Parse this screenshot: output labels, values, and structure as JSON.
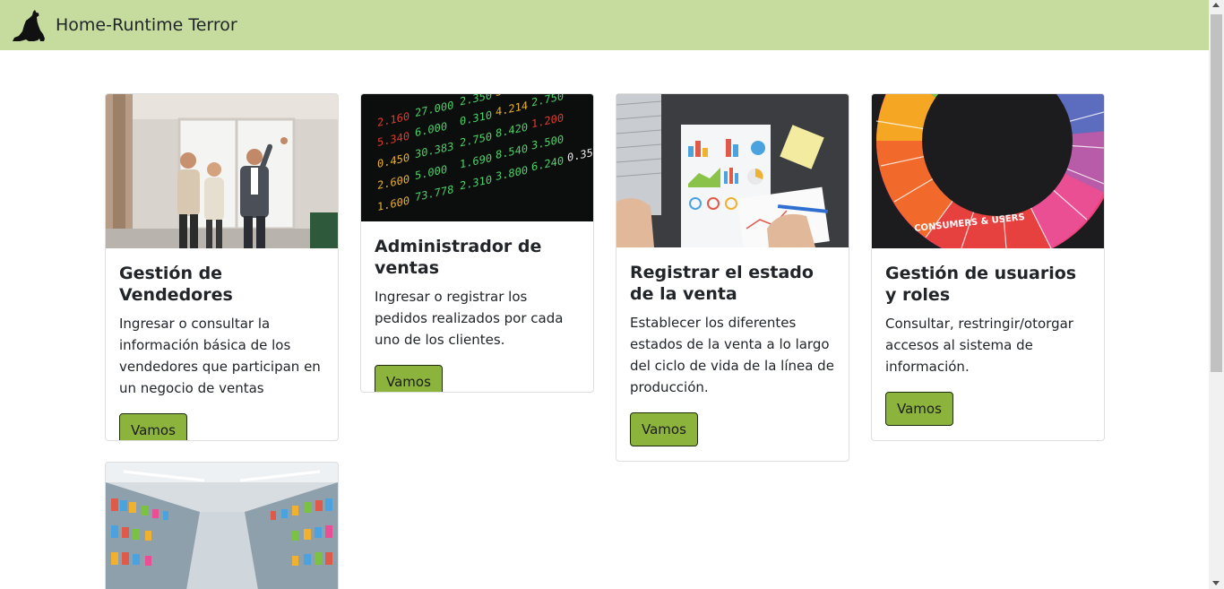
{
  "navbar": {
    "brand": "Home-Runtime Terror"
  },
  "cards": [
    {
      "title": "Gestión de Vendedores",
      "text": "Ingresar o consultar la información básica de los vendedores que participan en un negocio de ventas",
      "button": "Vamos"
    },
    {
      "title": "Administrador de ventas",
      "text": "Ingresar o registrar los pedidos realizados por cada uno de los clientes.",
      "button": "Vamos"
    },
    {
      "title": "Registrar el estado de la venta",
      "text": "Establecer los diferentes estados de la venta a lo largo del ciclo de vida de la línea de producción.",
      "button": "Vamos"
    },
    {
      "title": "Gestión de usuarios y roles",
      "text": "Consultar, restringir/otorgar accesos al sistema de información.",
      "button": "Vamos"
    }
  ],
  "image_texts": {
    "wheel_label": "CONSUMERS & USERS"
  },
  "icons": {
    "logo": "wolf-howling-icon"
  },
  "colors": {
    "navbar": "#c5dc9e",
    "button": "#8cb43c"
  }
}
